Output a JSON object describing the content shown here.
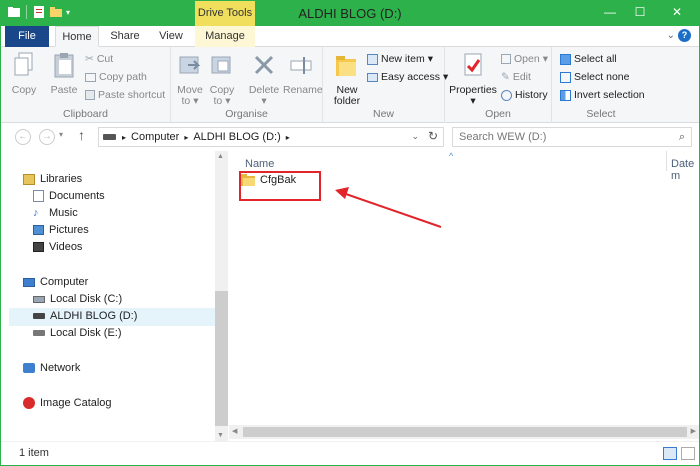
{
  "window": {
    "title": "ALDHI BLOG (D:)",
    "context_tab_header": "Drive Tools",
    "accent": "#2db14a"
  },
  "tabs": [
    {
      "label": "File"
    },
    {
      "label": "Home"
    },
    {
      "label": "Share"
    },
    {
      "label": "View"
    },
    {
      "label": "Manage"
    }
  ],
  "ribbon": {
    "clipboard": {
      "copy": "Copy",
      "paste": "Paste",
      "cut": "Cut",
      "copy_path": "Copy path",
      "paste_shortcut": "Paste shortcut",
      "label": "Clipboard"
    },
    "organise": {
      "move_to_1": "Move",
      "move_to_2": "to",
      "copy_to_1": "Copy",
      "copy_to_2": "to",
      "delete": "Delete",
      "rename": "Rename",
      "label": "Organise"
    },
    "new": {
      "new_folder_1": "New",
      "new_folder_2": "folder",
      "new_item": "New item",
      "easy_access": "Easy access",
      "label": "New"
    },
    "open": {
      "properties": "Properties",
      "open": "Open",
      "edit": "Edit",
      "history": "History",
      "label": "Open"
    },
    "select": {
      "select_all": "Select all",
      "select_none": "Select none",
      "invert": "Invert selection",
      "label": "Select"
    }
  },
  "address": {
    "crumbs": [
      "Computer",
      "ALDHI BLOG (D:)"
    ],
    "search_placeholder": "Search WEW (D:)"
  },
  "nav": {
    "libraries": "Libraries",
    "documents": "Documents",
    "music": "Music",
    "pictures": "Pictures",
    "videos": "Videos",
    "computer": "Computer",
    "disk_c": "Local Disk (C:)",
    "disk_d": "ALDHI BLOG (D:)",
    "disk_e": "Local Disk (E:)",
    "network": "Network",
    "image_catalog": "Image Catalog"
  },
  "content": {
    "col_name": "Name",
    "col_date": "Date m",
    "files": [
      {
        "name": "CfgBak"
      }
    ]
  },
  "status": {
    "count": "1 item"
  }
}
